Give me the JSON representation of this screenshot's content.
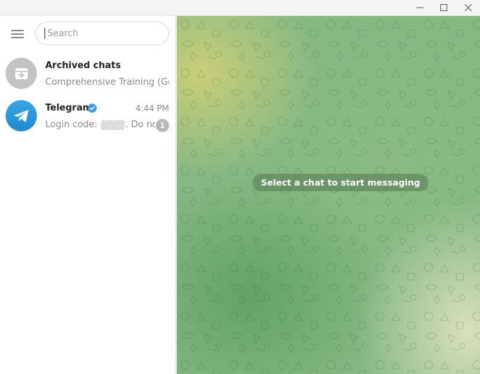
{
  "window": {
    "controls": [
      "minimize-icon",
      "maximize-icon",
      "close-icon"
    ]
  },
  "sidebar": {
    "menu_icon": "hamburger-menu-icon",
    "search": {
      "placeholder": "Search",
      "value": ""
    },
    "chats": [
      {
        "name": "Archived chats",
        "preview": "Comprehensive Training (Ge...",
        "avatar_icon": "archive-icon",
        "avatar_color": "#c3c3c3"
      },
      {
        "name": "Telegram",
        "verified": true,
        "time": "4:44 PM",
        "preview_prefix": "Login code: ",
        "preview_suffix": ". Do no...",
        "unread": "1",
        "avatar_icon": "telegram-logo-icon",
        "avatar_color": "#2a9de0"
      }
    ]
  },
  "main": {
    "empty_state": "Select a chat to start messaging",
    "accent_colors": {
      "wallpaper_base": "#86b884",
      "wallpaper_yellow": "#cdd078",
      "pill": "#567850"
    }
  }
}
